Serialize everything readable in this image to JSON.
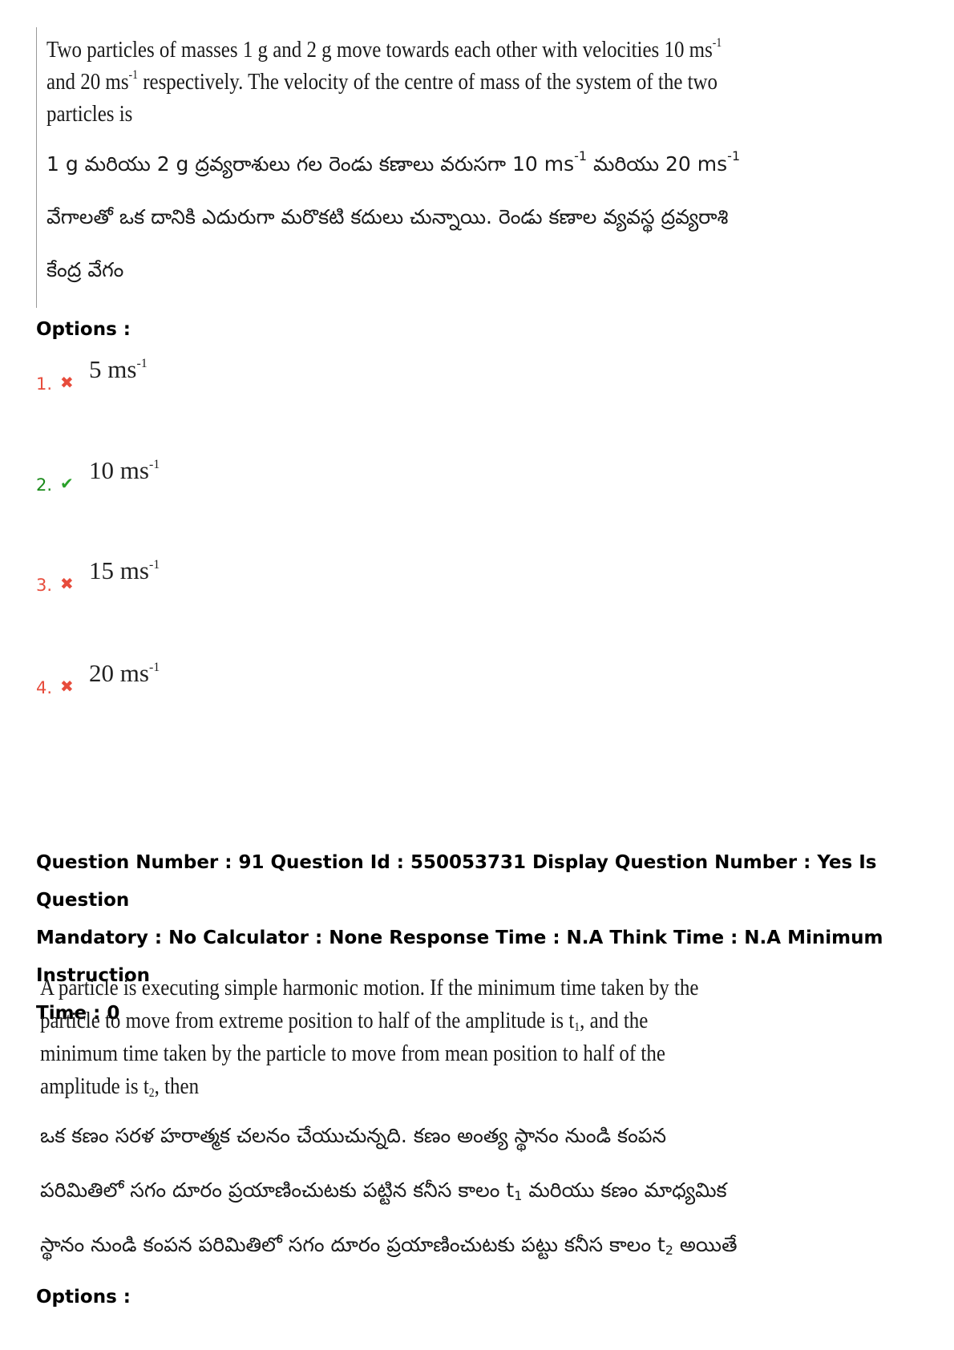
{
  "q1": {
    "en_lines": [
      "Two particles of masses 1 g and 2 g move towards each other with velocities 10 ms",
      "and 20 ms",
      " respectively.  The velocity of the centre of mass of the system of the two",
      "particles is"
    ],
    "sup": "-1",
    "te_line1_a": "1 g మరియు 2 g ద్రవ్యరాశులు గల రెండు కణాలు వరుసగా 10 ms",
    "te_line1_b": " మరియు 20 ms",
    "te_line2": "వేగాలతో ఒక దానికి ఎదురుగా మరొకటి కదులు చున్నాయి. రెండు కణాల వ్యవస్థ ద్రవ్యరాశి",
    "te_line3": "కేంద్ర వేగం"
  },
  "options_label": "Options :",
  "options": [
    {
      "num": "1.",
      "status": "wrong",
      "icon": "✖",
      "value": "5 ms",
      "sup": "-1"
    },
    {
      "num": "2.",
      "status": "right",
      "icon": "✔",
      "value": "10 ms",
      "sup": "-1"
    },
    {
      "num": "3.",
      "status": "wrong",
      "icon": "✖",
      "value": "15 ms",
      "sup": "-1"
    },
    {
      "num": "4.",
      "status": "wrong",
      "icon": "✖",
      "value": "20 ms",
      "sup": "-1"
    }
  ],
  "meta": {
    "line1": "Question Number : 91 Question Id : 550053731 Display Question Number : Yes Is Question",
    "line2": "Mandatory : No Calculator : None Response Time : N.A Think Time : N.A Minimum Instruction",
    "line3": "Time : 0"
  },
  "q2": {
    "en_line1": "A particle is executing simple harmonic motion.  If the minimum time taken by the",
    "en_line2_a": "particle  to  move  from  extreme  position  to  half  of  the  amplitude  is  t",
    "en_line2_sub": "1",
    "en_line2_b": ",  and  the",
    "en_line3": "minimum   time  taken  by  the  particle  to  move  from  mean  position  to  half  of  the",
    "en_line4_a": "amplitude is t",
    "en_line4_sub": "2",
    "en_line4_b": ", then",
    "te_line1": "ఒక కణం సరళ హరాత్మక చలనం చేయుచున్నది. కణం అంత్య స్థానం నుండి కంపన",
    "te_line2_a": "పరిమితిలో సగం దూరం ప్రయాణించుటకు పట్టిన కనీస కాలం t",
    "te_line2_sub": "1",
    "te_line2_b": " మరియు కణం మాధ్యమిక",
    "te_line3_a": "స్థానం నుండి కంపన పరిమితిలో సగం దూరం ప్రయాణించుటకు పట్టు కనీస కాలం t",
    "te_line3_sub": "2",
    "te_line3_b": " అయితే"
  },
  "options2_label": "Options :"
}
